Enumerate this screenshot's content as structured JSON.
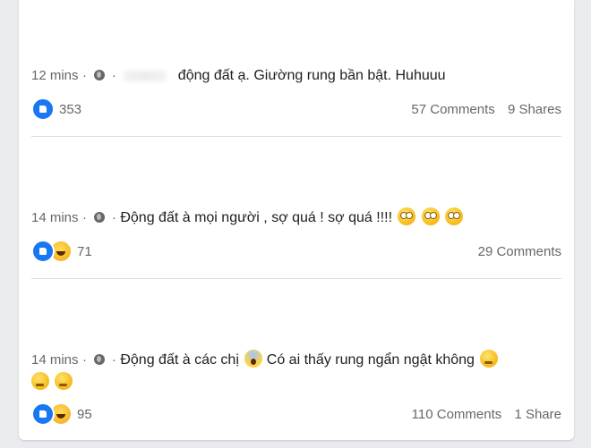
{
  "posts": [
    {
      "time": "12 mins",
      "text": "động đất ạ. Giường rung bần bật. Huhuuu",
      "reaction_count": "353",
      "comments": "57 Comments",
      "shares": "9 Shares"
    },
    {
      "time": "14 mins",
      "text": "Động đất à mọi người , sợ quá ! sợ quá !!!!",
      "reaction_count": "71",
      "comments": "29 Comments",
      "shares": ""
    },
    {
      "time": "14 mins",
      "text_a": "Động đất à các chị",
      "text_b": "Có ai thấy rung ngẩn ngật không",
      "reaction_count": "95",
      "comments": "110 Comments",
      "shares": "1 Share"
    }
  ],
  "separator": "·",
  "icons": {
    "audience": "globe-icon",
    "like": "like-icon",
    "haha": "haha-icon",
    "emoji_roll": "rolling-eyes-emoji",
    "emoji_scream": "screaming-emoji",
    "emoji_think": "thinking-emoji"
  },
  "colors": {
    "background": "#e9ebee",
    "card": "#ffffff",
    "meta": "#65676b",
    "like": "#1877f2"
  }
}
